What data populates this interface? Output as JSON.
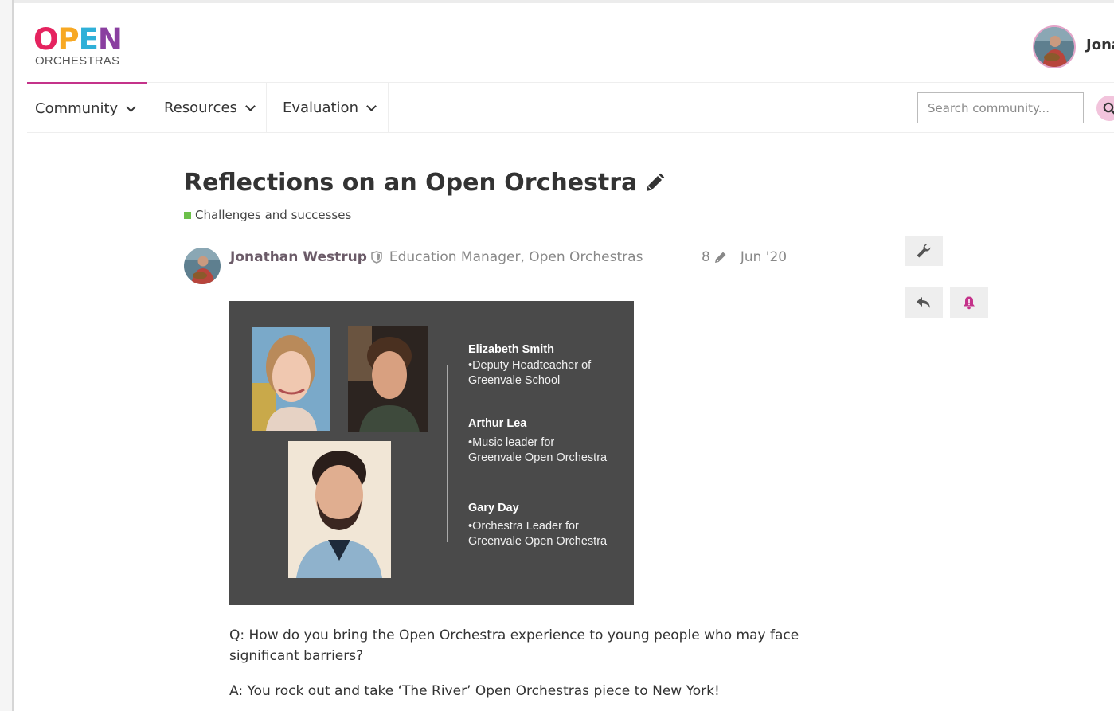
{
  "header": {
    "logo": {
      "word": [
        "O",
        "P",
        "E",
        "N"
      ],
      "colors": [
        "#e5235f",
        "#f7a823",
        "#2fb0d8",
        "#8a3fa0"
      ],
      "subtitle": "ORCHESTRAS"
    },
    "user": {
      "name": "Jonathan"
    }
  },
  "nav": {
    "items": [
      {
        "label": "Community",
        "active": true
      },
      {
        "label": "Resources",
        "active": false
      },
      {
        "label": "Evaluation",
        "active": false
      }
    ],
    "search": {
      "placeholder": "Search community..."
    }
  },
  "topic": {
    "title": "Reflections on an Open Orchestra",
    "category": {
      "name": "Challenges and successes",
      "color": "#6cc04a"
    }
  },
  "post": {
    "author": "Jonathan Westrup",
    "user_title": "Education Manager, Open Orchestras",
    "edit_count": "8",
    "date": "Jun '20",
    "slide": {
      "people": [
        {
          "name": "Elizabeth Smith",
          "role_lines": [
            "•Deputy Headteacher of",
            "Greenvale School"
          ]
        },
        {
          "name": "Arthur Lea",
          "role_lines": [
            "•Music leader for",
            "Greenvale Open Orchestra"
          ]
        },
        {
          "name": "Gary Day",
          "role_lines": [
            "•Orchestra Leader for",
            "Greenvale Open Orchestra"
          ]
        }
      ]
    },
    "body": [
      "Q: How do you bring the Open Orchestra experience to young people who may face significant barriers?",
      "A: You rock out and take ‘The River’ Open Orchestras piece to New York!"
    ]
  },
  "controls": {
    "icons": [
      "wrench-icon",
      "reply-icon",
      "bell-icon"
    ],
    "accent": "#c4328a"
  }
}
